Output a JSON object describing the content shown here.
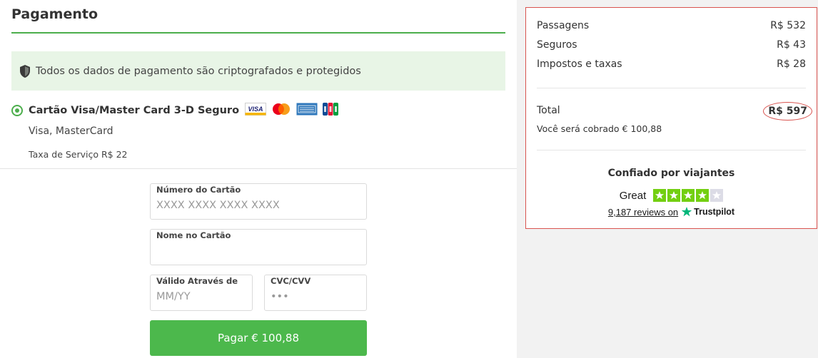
{
  "payment": {
    "title": "Pagamento",
    "secure_notice": "Todos os dados de pagamento são criptografados e protegidos",
    "method": {
      "label": "Cartão Visa/Master Card 3-D Seguro",
      "brands": "Visa, MasterCard",
      "service_fee": "Taxa de Serviço R$ 22",
      "logos": [
        "visa-logo",
        "mastercard-logo",
        "amex-logo",
        "jcb-logo"
      ]
    },
    "form": {
      "card_number": {
        "label": "Número do Cartão",
        "placeholder": "XXXX XXXX XXXX XXXX",
        "value": ""
      },
      "card_name": {
        "label": "Nome no Cartão",
        "placeholder": "",
        "value": ""
      },
      "expiry": {
        "label": "Válido Através de",
        "placeholder": "MM/YY",
        "value": ""
      },
      "cvc": {
        "label": "CVC/CVV",
        "placeholder": "•••",
        "value": ""
      }
    },
    "pay_button": "Pagar  € 100,88"
  },
  "summary": {
    "items": [
      {
        "label": "Passagens",
        "value": "R$ 532"
      },
      {
        "label": "Seguros",
        "value": "R$ 43"
      },
      {
        "label": "Impostos e taxas",
        "value": "R$ 28"
      }
    ],
    "total_label": "Total",
    "total_value": "R$ 597",
    "charge_note": "Você será cobrado € 100,88"
  },
  "trust": {
    "title": "Confiado por viajantes",
    "rating_word": "Great",
    "stars_filled": 4,
    "stars_total": 5,
    "reviews_link": "9,187 reviews on",
    "brand": "Trustpilot"
  },
  "colors": {
    "accent_green": "#4cae4c",
    "button_green": "#4cb84c",
    "banner_bg": "#e8f5e6",
    "highlight_red": "#d9534f",
    "trustpilot_green": "#00b67a",
    "star_green": "#73cf11"
  }
}
